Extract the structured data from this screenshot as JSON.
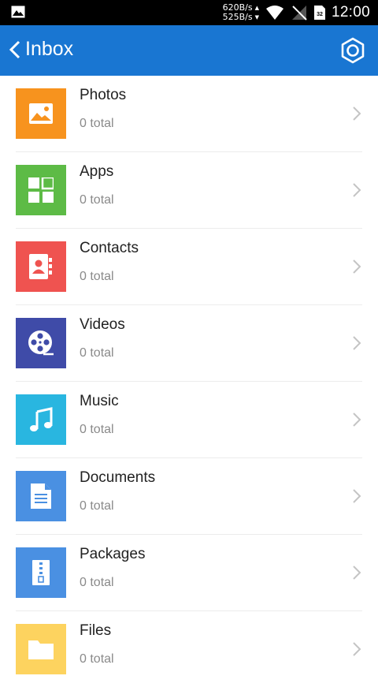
{
  "status_bar": {
    "speed_up": "620B/s",
    "speed_down": "525B/s",
    "sim_label": "32",
    "time": "12:00"
  },
  "app_bar": {
    "back_icon": "chevron-left-icon",
    "title": "Inbox",
    "settings_icon": "gear-icon"
  },
  "items": [
    {
      "label": "Photos",
      "count": "0 total",
      "color": "#f7931e",
      "icon": "image-icon"
    },
    {
      "label": "Apps",
      "count": "0 total",
      "color": "#5dbb46",
      "icon": "apps-icon"
    },
    {
      "label": "Contacts",
      "count": "0 total",
      "color": "#ef5350",
      "icon": "contacts-icon"
    },
    {
      "label": "Videos",
      "count": "0 total",
      "color": "#3f4ba8",
      "icon": "film-reel-icon"
    },
    {
      "label": "Music",
      "count": "0 total",
      "color": "#29b6e0",
      "icon": "music-note-icon"
    },
    {
      "label": "Documents",
      "count": "0 total",
      "color": "#4a90e2",
      "icon": "document-icon"
    },
    {
      "label": "Packages",
      "count": "0 total",
      "color": "#4a90e2",
      "icon": "archive-icon"
    },
    {
      "label": "Files",
      "count": "0 total",
      "color": "#fdd35f",
      "icon": "folder-icon"
    }
  ]
}
